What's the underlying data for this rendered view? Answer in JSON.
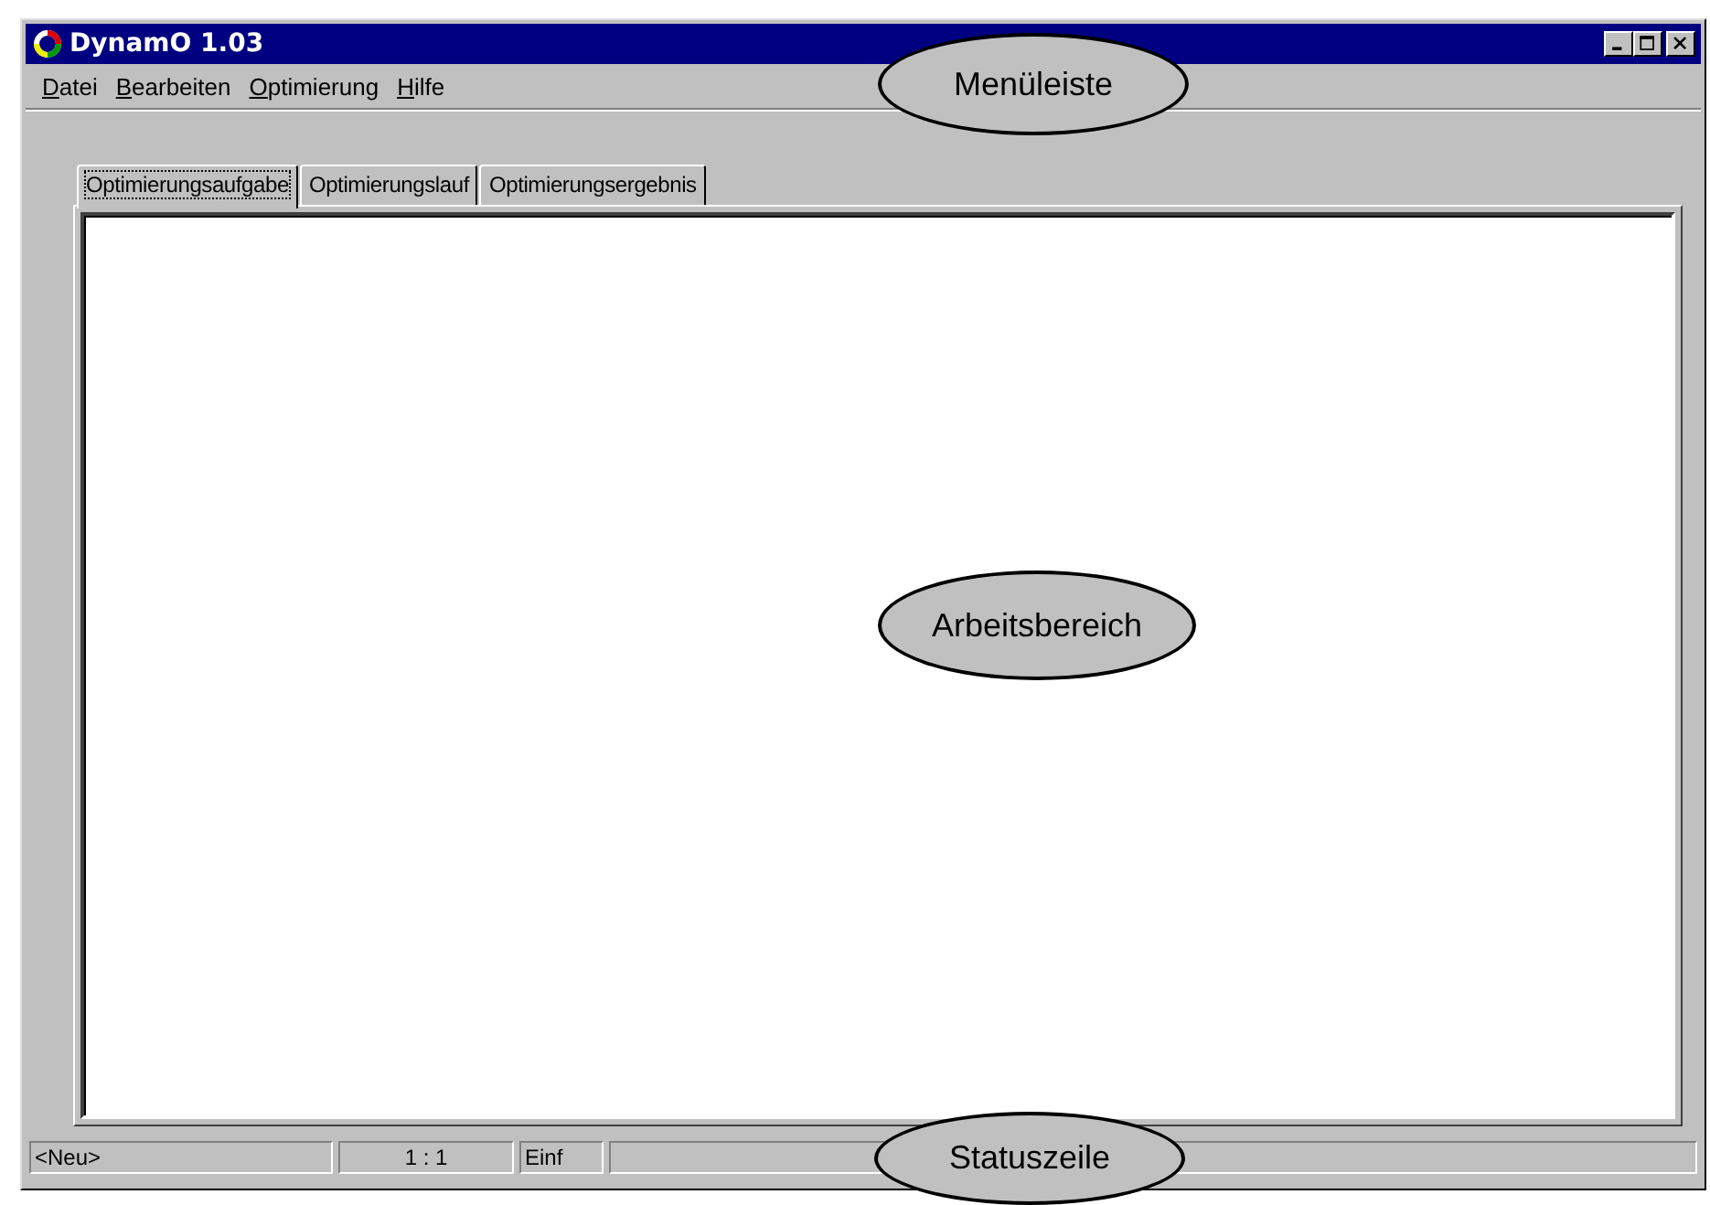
{
  "window": {
    "title": "DynamO 1.03"
  },
  "menu": [
    {
      "label": "Datei",
      "underlined_first": true
    },
    {
      "label": "Bearbeiten",
      "underlined_first": true
    },
    {
      "label": "Optimierung",
      "underlined_first": true
    },
    {
      "label": "Hilfe",
      "underlined_first": true
    }
  ],
  "tabs": [
    {
      "label": "Optimierungsaufgabe",
      "selected": true
    },
    {
      "label": "Optimierungslauf",
      "selected": false
    },
    {
      "label": "Optimierungsergebnis",
      "selected": false
    }
  ],
  "status_bar": [
    "<Neu>",
    "1 : 1",
    "Einf"
  ],
  "callouts": [
    "Menüleiste",
    "Arbeitsbereich",
    "Statuszeile"
  ]
}
